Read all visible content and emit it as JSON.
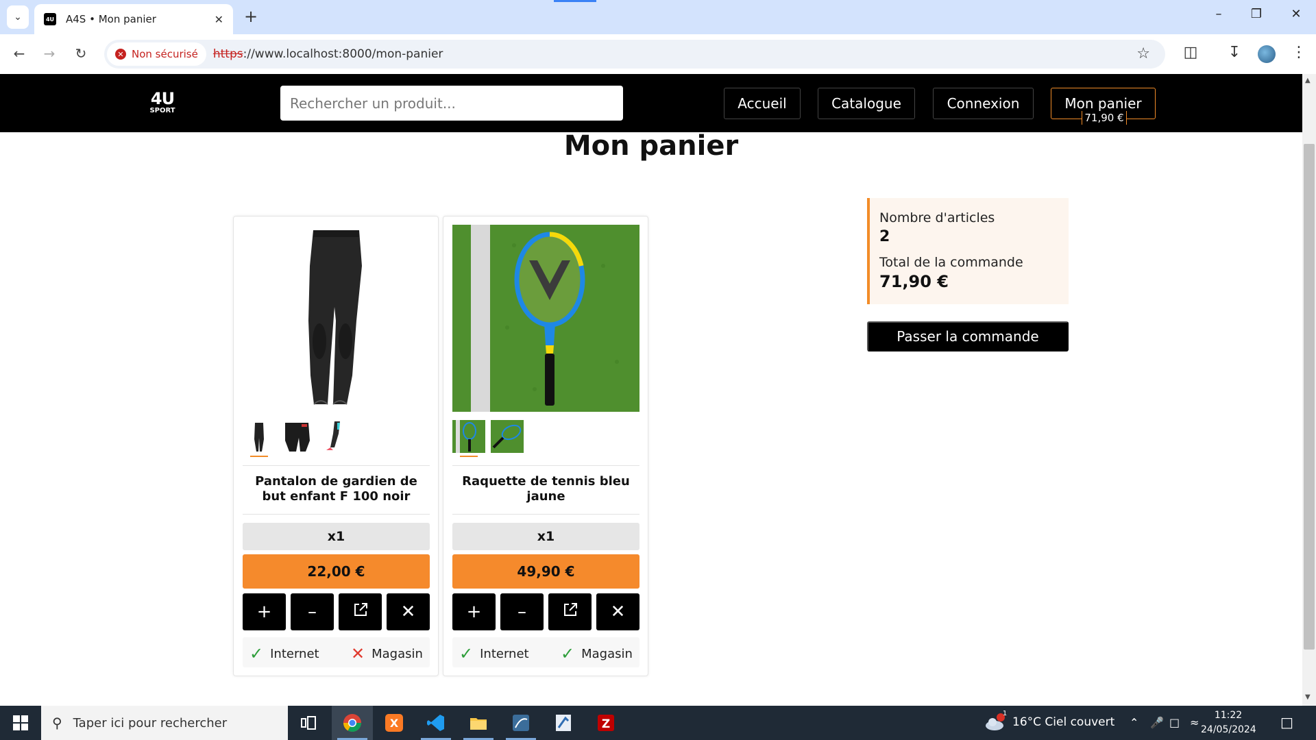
{
  "browser": {
    "tab_title": "A4S • Mon panier",
    "favicon_text": "4U",
    "security_label": "Non sécurisé",
    "url_scheme": "https",
    "url_rest": "://www.localhost:8000/mon-panier"
  },
  "site": {
    "logo_main": "4U",
    "logo_sub": "SPORT",
    "search_placeholder": "Rechercher un produit...",
    "nav": {
      "home": "Accueil",
      "catalog": "Catalogue",
      "login": "Connexion",
      "cart": "Mon panier",
      "cart_total": "71,90 €"
    }
  },
  "page": {
    "title": "Mon panier"
  },
  "cart_items": [
    {
      "name": "Pantalon de gardien de but enfant F 100 noir",
      "quantity": "x1",
      "price": "22,00 €",
      "availability": [
        {
          "label": "Internet",
          "available": true
        },
        {
          "label": "Magasin",
          "available": false
        }
      ]
    },
    {
      "name": "Raquette de tennis bleu jaune",
      "quantity": "x1",
      "price": "49,90 €",
      "availability": [
        {
          "label": "Internet",
          "available": true
        },
        {
          "label": "Magasin",
          "available": true
        }
      ]
    }
  ],
  "summary": {
    "items_label": "Nombre d'articles",
    "items_value": "2",
    "total_label": "Total de la commande",
    "total_value": "71,90 €",
    "order_button": "Passer la commande"
  },
  "taskbar": {
    "search_placeholder": "Taper ici pour rechercher",
    "weather": "16°C  Ciel couvert",
    "weather_badge": "1",
    "time": "11:22",
    "date": "24/05/2024"
  },
  "colors": {
    "accent": "#f58a2c",
    "header_bg": "#000000",
    "available": "#2e9e3a",
    "unavailable": "#e03a2e"
  }
}
